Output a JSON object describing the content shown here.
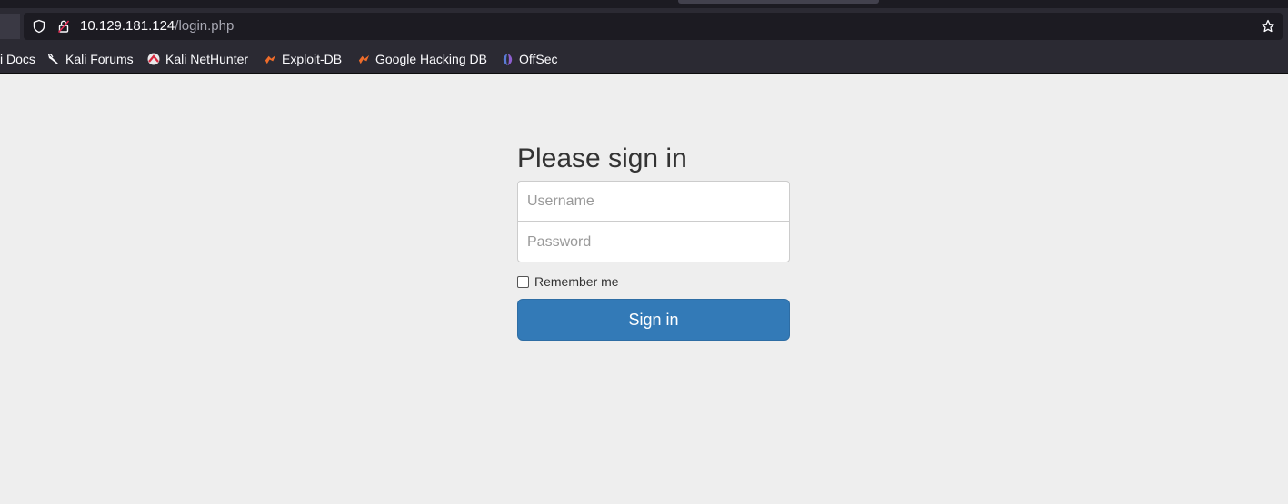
{
  "browser": {
    "url_host": "10.129.181.124",
    "url_path": "/login.php",
    "bookmarks": [
      {
        "label": "i Docs"
      },
      {
        "label": "Kali Forums"
      },
      {
        "label": "Kali NetHunter"
      },
      {
        "label": "Exploit-DB"
      },
      {
        "label": "Google Hacking DB"
      },
      {
        "label": "OffSec"
      }
    ]
  },
  "login": {
    "title": "Please sign in",
    "username_placeholder": "Username",
    "password_placeholder": "Password",
    "remember_label": "Remember me",
    "signin_label": "Sign in"
  },
  "colors": {
    "chrome_bg": "#2b2a33",
    "page_bg": "#eeeeee",
    "button_bg": "#337ab7"
  }
}
